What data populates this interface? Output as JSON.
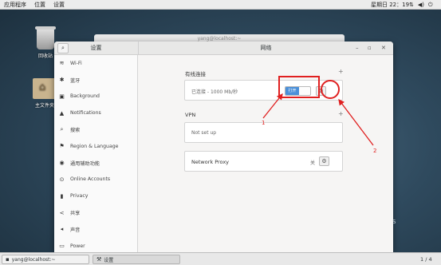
{
  "topbar": {
    "menu": [
      "应用程序",
      "位置",
      "设置"
    ],
    "clock": "星期日 22：19",
    "tray_icons": [
      "network-icon",
      "volume-icon",
      "power-icon"
    ]
  },
  "desktop": {
    "icons": [
      {
        "label": "回收站",
        "icon": "trash-icon"
      },
      {
        "label": "主文件夹",
        "icon": "home-folder-icon"
      }
    ],
    "background_window_title": "yang@localhost:~",
    "corner_mark": "S"
  },
  "window": {
    "sidebar_title": "设置",
    "main_title": "网络",
    "controls": [
      "–",
      "▫",
      "✕"
    ]
  },
  "sidebar": {
    "items": [
      {
        "icon": "wifi-icon",
        "glyph": "≋",
        "label": "Wi-Fi"
      },
      {
        "icon": "bluetooth-icon",
        "glyph": "✱",
        "label": "蓝牙"
      },
      {
        "icon": "background-icon",
        "glyph": "▣",
        "label": "Background"
      },
      {
        "icon": "notifications-icon",
        "glyph": "▲",
        "label": "Notifications"
      },
      {
        "icon": "search-icon",
        "glyph": "⌕",
        "label": "搜索"
      },
      {
        "icon": "region-icon",
        "glyph": "⚑",
        "label": "Region & Language"
      },
      {
        "icon": "accessibility-icon",
        "glyph": "◉",
        "label": "通用辅助功能"
      },
      {
        "icon": "online-accounts-icon",
        "glyph": "⊙",
        "label": "Online Accounts"
      },
      {
        "icon": "privacy-icon",
        "glyph": "▮",
        "label": "Privacy"
      },
      {
        "icon": "sharing-icon",
        "glyph": "<",
        "label": "共享"
      },
      {
        "icon": "sound-icon",
        "glyph": "◂",
        "label": "声音"
      },
      {
        "icon": "power-icon",
        "glyph": "▭",
        "label": "Power"
      }
    ]
  },
  "network": {
    "wired_title": "有线连接",
    "wired_status": "已连接 - 1000 Mb/秒",
    "wired_toggle_label": "打开",
    "vpn_title": "VPN",
    "vpn_status": "Not set up",
    "proxy_label": "Network Proxy",
    "proxy_status": "关"
  },
  "annotations": {
    "label1": "1",
    "label2": "2"
  },
  "taskbar": {
    "tasks": [
      {
        "icon": "terminal-icon",
        "label": "yang@localhost:~"
      },
      {
        "icon": "settings-icon",
        "label": "设置"
      }
    ],
    "pager": "1 / 4"
  },
  "colors": {
    "accent": "#4a90d9",
    "annotation": "#e02020"
  }
}
